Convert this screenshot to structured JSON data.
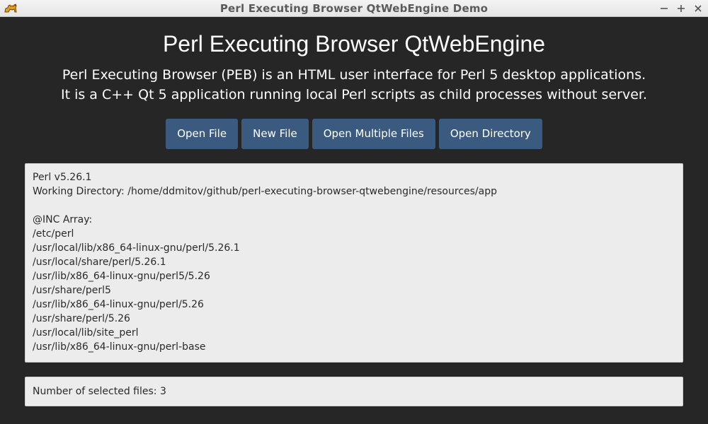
{
  "window": {
    "title": "Perl Executing Browser QtWebEngine Demo",
    "icon": "camel-icon",
    "controls": [
      "minimize-icon",
      "maximize-icon",
      "close-icon"
    ]
  },
  "page": {
    "heading": "Perl Executing Browser QtWebEngine",
    "subtitle_line1": "Perl Executing Browser (PEB) is an HTML user interface for Perl 5 desktop applications.",
    "subtitle_line2": "It is a C++ Qt 5 application running local Perl scripts as child processes without server."
  },
  "buttons": {
    "open_file": "Open File",
    "new_file": "New File",
    "open_multiple": "Open Multiple Files",
    "open_directory": "Open Directory"
  },
  "info": {
    "perl_version": "Perl v5.26.1",
    "working_directory": "Working Directory: /home/ddmitov/github/perl-executing-browser-qtwebengine/resources/app",
    "inc_label": "@INC Array:",
    "inc_paths": [
      "/etc/perl",
      "/usr/local/lib/x86_64-linux-gnu/perl/5.26.1",
      "/usr/local/share/perl/5.26.1",
      "/usr/lib/x86_64-linux-gnu/perl5/5.26",
      "/usr/share/perl5",
      "/usr/lib/x86_64-linux-gnu/perl/5.26",
      "/usr/share/perl/5.26",
      "/usr/local/lib/site_perl",
      "/usr/lib/x86_64-linux-gnu/perl-base"
    ]
  },
  "status": {
    "selected_files": "Number of selected files: 3"
  },
  "colors": {
    "background": "#262626",
    "button": "#3a5a7f",
    "panel": "#ececec",
    "titlebar": "#eeeeee"
  }
}
